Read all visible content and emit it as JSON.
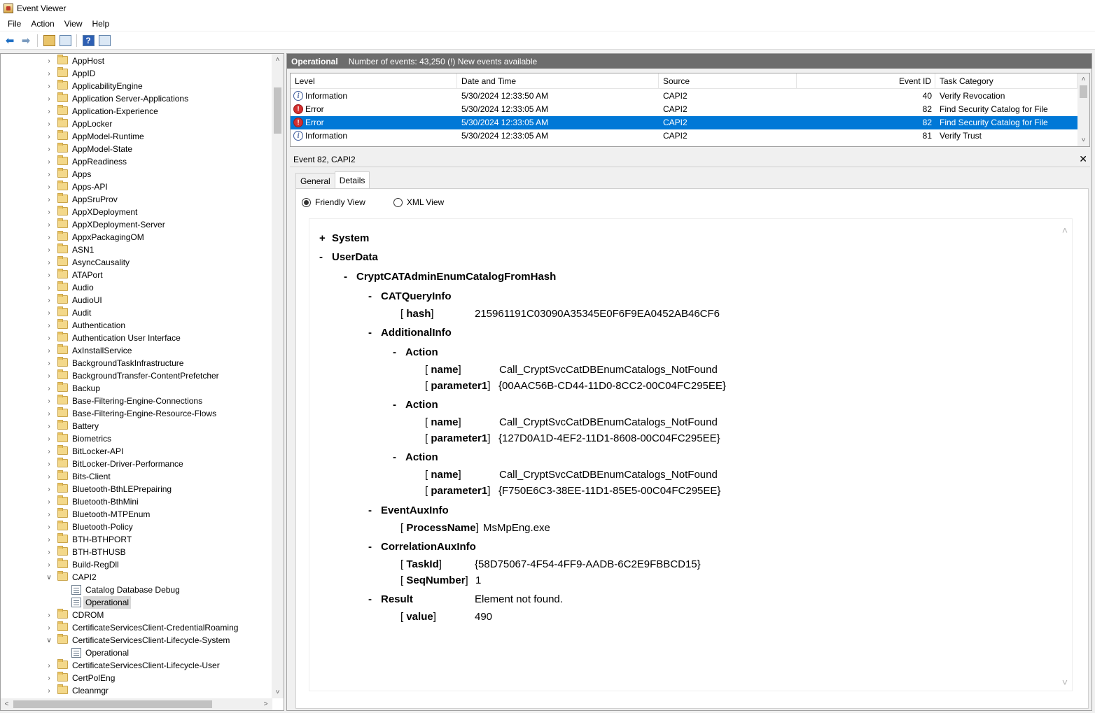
{
  "window": {
    "title": "Event Viewer"
  },
  "menu": [
    "File",
    "Action",
    "View",
    "Help"
  ],
  "toolbar": {
    "icons": [
      "back-arrow-icon",
      "forward-arrow-icon",
      "up-folder-icon",
      "console-tree-icon",
      "help-icon",
      "action-pane-icon"
    ]
  },
  "tree": {
    "items": [
      {
        "label": "AppHost",
        "type": "folder",
        "expanded": false
      },
      {
        "label": "AppID",
        "type": "folder",
        "expanded": false
      },
      {
        "label": "ApplicabilityEngine",
        "type": "folder",
        "expanded": false
      },
      {
        "label": "Application Server-Applications",
        "type": "folder",
        "expanded": false
      },
      {
        "label": "Application-Experience",
        "type": "folder",
        "expanded": false
      },
      {
        "label": "AppLocker",
        "type": "folder",
        "expanded": false
      },
      {
        "label": "AppModel-Runtime",
        "type": "folder",
        "expanded": false
      },
      {
        "label": "AppModel-State",
        "type": "folder",
        "expanded": false
      },
      {
        "label": "AppReadiness",
        "type": "folder",
        "expanded": false
      },
      {
        "label": "Apps",
        "type": "folder",
        "expanded": false
      },
      {
        "label": "Apps-API",
        "type": "folder",
        "expanded": false
      },
      {
        "label": "AppSruProv",
        "type": "folder",
        "expanded": false
      },
      {
        "label": "AppXDeployment",
        "type": "folder",
        "expanded": false
      },
      {
        "label": "AppXDeployment-Server",
        "type": "folder",
        "expanded": false
      },
      {
        "label": "AppxPackagingOM",
        "type": "folder",
        "expanded": false
      },
      {
        "label": "ASN1",
        "type": "folder",
        "expanded": false
      },
      {
        "label": "AsyncCausality",
        "type": "folder",
        "expanded": false
      },
      {
        "label": "ATAPort",
        "type": "folder",
        "expanded": false
      },
      {
        "label": "Audio",
        "type": "folder",
        "expanded": false
      },
      {
        "label": "AudioUI",
        "type": "folder",
        "expanded": false
      },
      {
        "label": "Audit",
        "type": "folder",
        "expanded": false
      },
      {
        "label": "Authentication",
        "type": "folder",
        "expanded": false
      },
      {
        "label": "Authentication User Interface",
        "type": "folder",
        "expanded": false
      },
      {
        "label": "AxInstallService",
        "type": "folder",
        "expanded": false
      },
      {
        "label": "BackgroundTaskInfrastructure",
        "type": "folder",
        "expanded": false
      },
      {
        "label": "BackgroundTransfer-ContentPrefetcher",
        "type": "folder",
        "expanded": false
      },
      {
        "label": "Backup",
        "type": "folder",
        "expanded": false
      },
      {
        "label": "Base-Filtering-Engine-Connections",
        "type": "folder",
        "expanded": false
      },
      {
        "label": "Base-Filtering-Engine-Resource-Flows",
        "type": "folder",
        "expanded": false
      },
      {
        "label": "Battery",
        "type": "folder",
        "expanded": false
      },
      {
        "label": "Biometrics",
        "type": "folder",
        "expanded": false
      },
      {
        "label": "BitLocker-API",
        "type": "folder",
        "expanded": false
      },
      {
        "label": "BitLocker-Driver-Performance",
        "type": "folder",
        "expanded": false
      },
      {
        "label": "Bits-Client",
        "type": "folder",
        "expanded": false
      },
      {
        "label": "Bluetooth-BthLEPrepairing",
        "type": "folder",
        "expanded": false
      },
      {
        "label": "Bluetooth-BthMini",
        "type": "folder",
        "expanded": false
      },
      {
        "label": "Bluetooth-MTPEnum",
        "type": "folder",
        "expanded": false
      },
      {
        "label": "Bluetooth-Policy",
        "type": "folder",
        "expanded": false
      },
      {
        "label": "BTH-BTHPORT",
        "type": "folder",
        "expanded": false
      },
      {
        "label": "BTH-BTHUSB",
        "type": "folder",
        "expanded": false
      },
      {
        "label": "Build-RegDll",
        "type": "folder",
        "expanded": false
      },
      {
        "label": "CAPI2",
        "type": "folder",
        "expanded": true
      },
      {
        "label": "Catalog Database Debug",
        "type": "log",
        "selected": false
      },
      {
        "label": "Operational",
        "type": "log",
        "selected": true
      },
      {
        "label": "CDROM",
        "type": "folder",
        "expanded": false
      },
      {
        "label": "CertificateServicesClient-CredentialRoaming",
        "type": "folder",
        "expanded": false
      },
      {
        "label": "CertificateServicesClient-Lifecycle-System",
        "type": "folder",
        "expanded": true
      },
      {
        "label": "Operational",
        "type": "log",
        "selected": false
      },
      {
        "label": "CertificateServicesClient-Lifecycle-User",
        "type": "folder",
        "expanded": false
      },
      {
        "label": "CertPolEng",
        "type": "folder",
        "expanded": false
      },
      {
        "label": "Cleanmgr",
        "type": "folder",
        "expanded": false
      }
    ]
  },
  "log_header": {
    "title": "Operational",
    "info": "Number of events: 43,250 (!) New events available"
  },
  "grid": {
    "columns": [
      "Level",
      "Date and Time",
      "Source",
      "Event ID",
      "Task Category"
    ],
    "rows": [
      {
        "level": "Information",
        "icon": "information-icon",
        "date": "5/30/2024 12:33:50 AM",
        "source": "CAPI2",
        "event_id": "40",
        "task": "Verify Revocation",
        "selected": false
      },
      {
        "level": "Error",
        "icon": "error-icon",
        "date": "5/30/2024 12:33:05 AM",
        "source": "CAPI2",
        "event_id": "82",
        "task": "Find Security Catalog for File",
        "selected": false
      },
      {
        "level": "Error",
        "icon": "error-icon",
        "date": "5/30/2024 12:33:05 AM",
        "source": "CAPI2",
        "event_id": "82",
        "task": "Find Security Catalog for File",
        "selected": true
      },
      {
        "level": "Information",
        "icon": "information-icon",
        "date": "5/30/2024 12:33:05 AM",
        "source": "CAPI2",
        "event_id": "81",
        "task": "Verify Trust",
        "selected": false
      }
    ]
  },
  "detail": {
    "title": "Event 82, CAPI2",
    "tabs": [
      "General",
      "Details"
    ],
    "active_tab": "Details",
    "views": [
      "Friendly View",
      "XML View"
    ],
    "selected_view": "Friendly View",
    "tree": {
      "system": {
        "sign": "+",
        "label": "System"
      },
      "userdata": {
        "sign": "-",
        "label": "UserData"
      },
      "crypt": {
        "sign": "-",
        "label": "CryptCATAdminEnumCatalogFromHash"
      },
      "catquery": {
        "sign": "-",
        "label": "CATQueryInfo"
      },
      "hash": {
        "key": "hash",
        "value": "215961191C03090A35345E0F6F9EA0452AB46CF6"
      },
      "additional": {
        "sign": "-",
        "label": "AdditionalInfo"
      },
      "actions": [
        {
          "sign": "-",
          "label": "Action",
          "name": "Call_CryptSvcCatDBEnumCatalogs_NotFound",
          "parameter1": "{00AAC56B-CD44-11D0-8CC2-00C04FC295EE}"
        },
        {
          "sign": "-",
          "label": "Action",
          "name": "Call_CryptSvcCatDBEnumCatalogs_NotFound",
          "parameter1": "{127D0A1D-4EF2-11D1-8608-00C04FC295EE}"
        },
        {
          "sign": "-",
          "label": "Action",
          "name": "Call_CryptSvcCatDBEnumCatalogs_NotFound",
          "parameter1": "{F750E6C3-38EE-11D1-85E5-00C04FC295EE}"
        }
      ],
      "keys": {
        "name": "name",
        "parameter1": "parameter1",
        "process": "ProcessName",
        "taskid": "TaskId",
        "seq": "SeqNumber",
        "value": "value"
      },
      "eventaux": {
        "sign": "-",
        "label": "EventAuxInfo",
        "process_name": "MsMpEng.exe"
      },
      "correlation": {
        "sign": "-",
        "label": "CorrelationAuxInfo",
        "task_id": "{58D75067-4F54-4FF9-AADB-6C2E9FBBCD15}",
        "seq_number": "1"
      },
      "result": {
        "sign": "-",
        "label": "Result",
        "text": "Element not found.",
        "value": "490"
      }
    }
  }
}
